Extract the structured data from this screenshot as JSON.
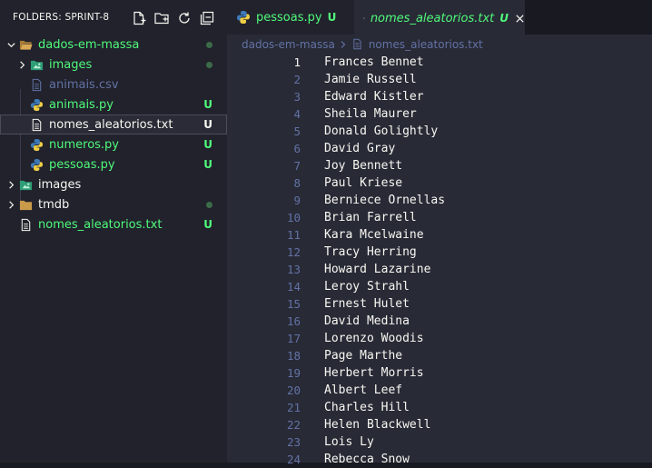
{
  "sidebar": {
    "title": "FOLDERS: SPRINT-8",
    "actions": [
      "new-file-icon",
      "new-folder-icon",
      "refresh-icon",
      "collapse-all-icon"
    ],
    "items": [
      {
        "label": "dados-em-massa",
        "kind": "folder-open",
        "level": 0,
        "color": "green",
        "decoration": "dot"
      },
      {
        "label": "images",
        "kind": "image-folder",
        "level": 1,
        "color": "green",
        "decoration": "dot"
      },
      {
        "label": "animais.csv",
        "kind": "file",
        "level": 1,
        "color": "muted",
        "decoration": ""
      },
      {
        "label": "animais.py",
        "kind": "python",
        "level": 1,
        "color": "green",
        "decoration": "U"
      },
      {
        "label": "nomes_aleatorios.txt",
        "kind": "file",
        "level": 1,
        "color": "white",
        "decoration": "U",
        "selected": true
      },
      {
        "label": "numeros.py",
        "kind": "python",
        "level": 1,
        "color": "green",
        "decoration": "U"
      },
      {
        "label": "pessoas.py",
        "kind": "python",
        "level": 1,
        "color": "green",
        "decoration": "U"
      },
      {
        "label": "images",
        "kind": "image-folder",
        "level": 0,
        "color": "white",
        "decoration": ""
      },
      {
        "label": "tmdb",
        "kind": "folder",
        "level": 0,
        "color": "white",
        "decoration": "dot"
      },
      {
        "label": "nomes_aleatorios.txt",
        "kind": "file",
        "level": 0,
        "color": "green",
        "decoration": "U"
      }
    ]
  },
  "tabs": [
    {
      "label": "pessoas.py",
      "status": "U",
      "icon": "python-icon"
    },
    {
      "label": "nomes_aleatorios.txt",
      "status": "U",
      "icon": "file-icon",
      "active": true
    }
  ],
  "breadcrumb": {
    "folder": "dados-em-massa",
    "file": "nomes_aleatorios.txt"
  },
  "editor": {
    "active_line": 1,
    "lines": [
      "Frances Bennet",
      "Jamie Russell",
      "Edward Kistler",
      "Sheila Maurer",
      "Donald Golightly",
      "David Gray",
      "Joy Bennett",
      "Paul Kriese",
      "Berniece Ornellas",
      "Brian Farrell",
      "Kara Mcelwaine",
      "Tracy Herring",
      "Howard Lazarine",
      "Leroy Strahl",
      "Ernest Hulet",
      "David Medina",
      "Lorenzo Woodis",
      "Page Marthe",
      "Herbert Morris",
      "Albert Leef",
      "Charles Hill",
      "Helen Blackwell",
      "Lois Ly",
      "Rebecca Snow"
    ]
  },
  "colors": {
    "green": "#50fa7b",
    "muted": "#6272a4",
    "editor_bg": "#282a36",
    "sidebar_bg": "#21222c",
    "folder": "#c89a4a",
    "python_blue": "#3d7ab8",
    "python_yellow": "#f0cf45"
  }
}
